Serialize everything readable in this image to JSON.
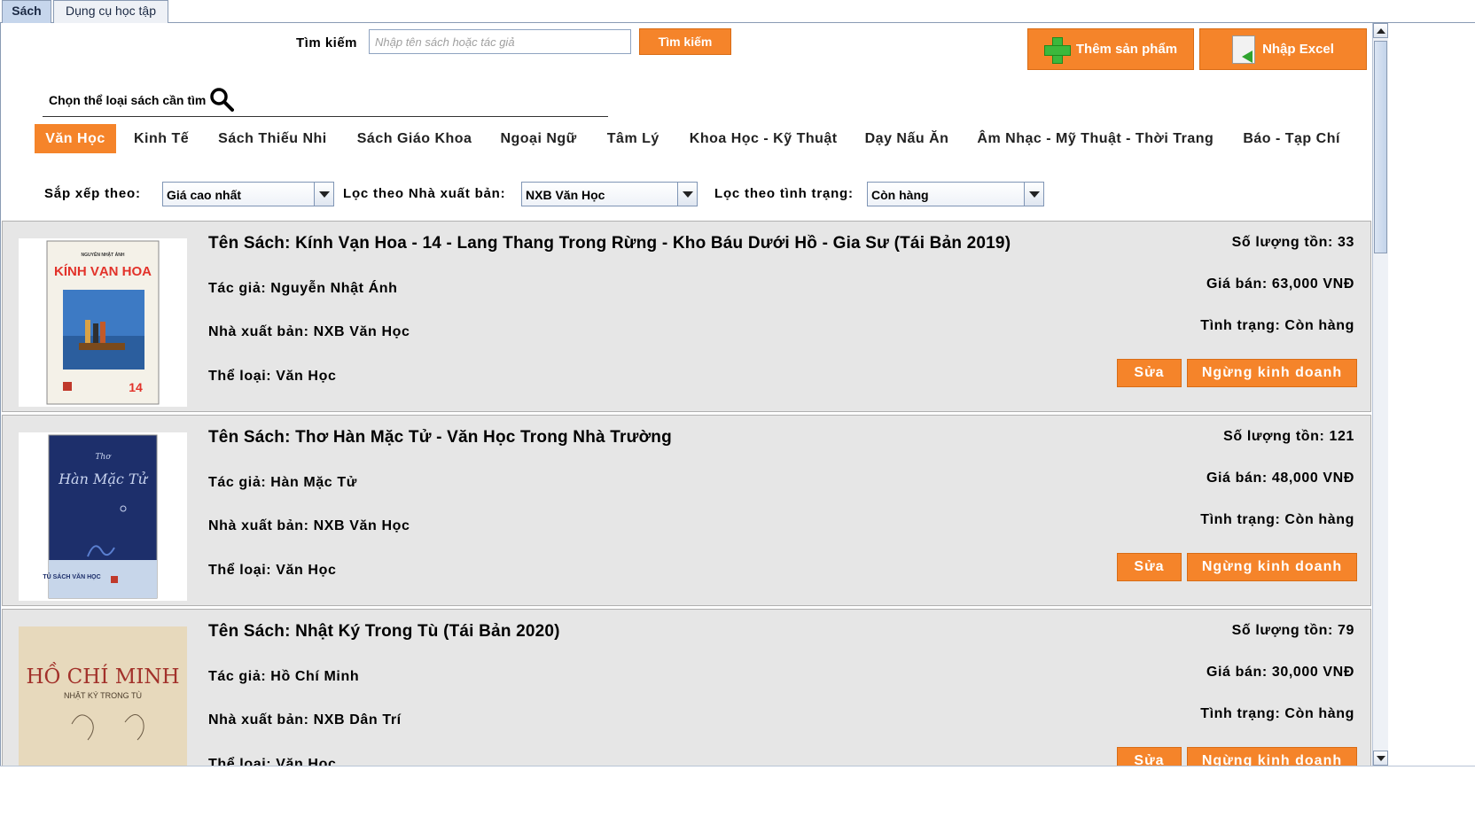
{
  "tabs": [
    {
      "label": "Sách",
      "active": true
    },
    {
      "label": "Dụng cụ học tập",
      "active": false
    }
  ],
  "search": {
    "label": "Tìm kiếm",
    "placeholder": "Nhập tên sách hoặc tác giả",
    "button_label": "Tìm kiếm"
  },
  "actions": {
    "add_label": "Thêm sản phẩm",
    "import_label": "Nhập Excel"
  },
  "category_prompt": "Chọn thể loại sách cần tìm",
  "categories": [
    {
      "label": "Văn Học",
      "active": true
    },
    {
      "label": "Kinh Tế"
    },
    {
      "label": "Sách Thiếu Nhi"
    },
    {
      "label": "Sách Giáo Khoa"
    },
    {
      "label": "Ngoại Ngữ"
    },
    {
      "label": "Tâm Lý"
    },
    {
      "label": "Khoa Học - Kỹ Thuật"
    },
    {
      "label": "Dạy Nấu Ăn"
    },
    {
      "label": "Âm Nhạc - Mỹ Thuật - Thời Trang"
    },
    {
      "label": "Báo - Tạp Chí"
    }
  ],
  "filters": {
    "sort_label": "Sắp xếp theo:",
    "sort_value": "Giá cao nhất",
    "publisher_label": "Lọc theo Nhà xuất bản:",
    "publisher_value": "NXB Văn Học",
    "status_label": "Lọc theo tình trạng:",
    "status_value": "Còn hàng"
  },
  "products": [
    {
      "title": "Tên Sách: Kính Vạn Hoa - 14 - Lang Thang Trong Rừng - Kho Báu Dưới Hồ - Gia Sư (Tái Bản 2019)",
      "author": "Tác giả: Nguyễn Nhật Ánh",
      "publisher": "Nhà xuất bản: NXB Văn Học",
      "category": "Thể loại: Văn Học",
      "stock": "Số lượng tồn: 33",
      "price": "Giá bán: 63,000 VNĐ",
      "status": "Tình trạng: Còn hàng",
      "cover": {
        "top_text": "NGUYỄN NHẬT ÁNH",
        "main_text": "KÍNH VẠN HOA",
        "number": "14"
      }
    },
    {
      "title": "Tên Sách: Thơ Hàn Mặc Tử - Văn Học Trong Nhà Trường",
      "author": "Tác giả: Hàn Mặc Tử",
      "publisher": "Nhà xuất bản: NXB Văn Học",
      "category": "Thể loại: Văn Học",
      "stock": "Số lượng tồn: 121",
      "price": "Giá bán: 48,000 VNĐ",
      "status": "Tình trạng: Còn hàng",
      "cover": {
        "top_text": "Thơ",
        "main_text": "Hàn Mặc Tử",
        "series": "TỦ SÁCH VĂN HỌC"
      }
    },
    {
      "title": "Tên Sách: Nhật Ký Trong Tù (Tái Bản 2020)",
      "author": "Tác giả: Hồ Chí Minh",
      "publisher": "Nhà xuất bản: NXB Dân Trí",
      "category": "Thể loại: Văn Học",
      "stock": "Số lượng tồn: 79",
      "price": "Giá bán: 30,000 VNĐ",
      "status": "Tình trạng: Còn hàng",
      "cover": {
        "main_text": "HỒ CHÍ MINH",
        "sub_text": "NHẬT KÝ TRONG TÙ"
      }
    }
  ],
  "card_actions": {
    "edit_label": "Sửa",
    "stop_label": "Ngừng kinh doanh"
  },
  "colors": {
    "accent": "#f5842a",
    "card_bg": "#e6e6e6",
    "tab_active": "#c6d6ec"
  }
}
